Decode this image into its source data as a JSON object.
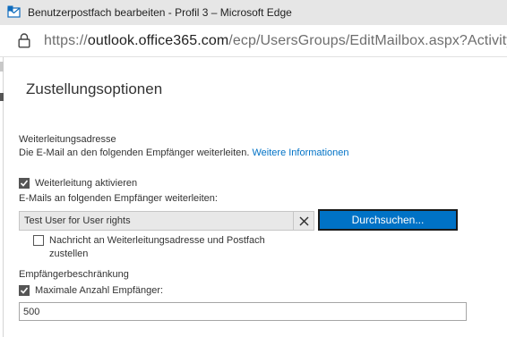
{
  "window": {
    "title": "Benutzerpostfach bearbeiten - Profil 3 – Microsoft Edge",
    "app_icon": "mailbox-icon"
  },
  "address_bar": {
    "icon": "lock-icon",
    "url_scheme": "https://",
    "url_host": "outlook.office365.com",
    "url_path": "/ecp/UsersGroups/EditMailbox.aspx?Activity"
  },
  "page": {
    "title": "Zustellungsoptionen"
  },
  "forwarding": {
    "section_label": "Weiterleitungsadresse",
    "description": "Die E-Mail an den folgenden Empfänger weiterleiten.",
    "more_info_link": "Weitere Informationen",
    "enable_label": "Weiterleitung aktivieren",
    "enable_checked": true,
    "forward_to_label": "E-Mails an folgenden Empfänger weiterleiten:",
    "recipient_value": "Test User for User rights",
    "remove_icon": "close-icon",
    "browse_label": "Durchsuchen...",
    "deliver_both_label_line1": "Nachricht an Weiterleitungsadresse und Postfach",
    "deliver_both_label_line2": "zustellen",
    "deliver_both_checked": false
  },
  "recipient_limit": {
    "section_label": "Empfängerbeschränkung",
    "max_label": "Maximale Anzahl Empfänger:",
    "max_checked": true,
    "max_value": "500"
  },
  "colors": {
    "accent": "#0072c6",
    "titlebar_bg": "#e6e6e6",
    "text": "#333333"
  }
}
